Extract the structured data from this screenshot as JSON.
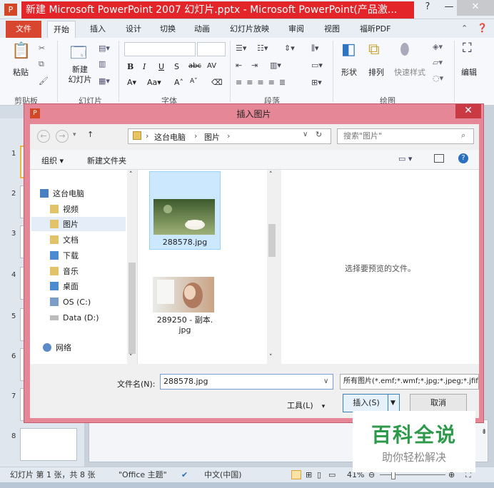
{
  "window": {
    "title": "新建 Microsoft PowerPoint 2007 幻灯片.pptx - Microsoft PowerPoint(产品激..."
  },
  "ribbon": {
    "tabs": [
      "文件",
      "开始",
      "插入",
      "设计",
      "切换",
      "动画",
      "幻灯片放映",
      "审阅",
      "视图",
      "福昕PDF"
    ],
    "groups": {
      "clipboard": {
        "label": "剪贴板",
        "paste": "粘贴"
      },
      "slides": {
        "label": "幻灯片",
        "new_slide": "新建\n幻灯片"
      },
      "font": {
        "label": "字体"
      },
      "paragraph": {
        "label": "段落"
      },
      "drawing": {
        "label": "绘图",
        "shapes": "形状",
        "arrange": "排列",
        "quick_styles": "快速样式"
      },
      "editing": {
        "label": "编辑"
      }
    }
  },
  "slides": {
    "numbers": [
      "1",
      "2",
      "3",
      "4",
      "5",
      "6",
      "7",
      "8"
    ]
  },
  "dialog": {
    "title": "插入图片",
    "breadcrumb": [
      "这台电脑",
      "图片"
    ],
    "search_placeholder": "搜索\"图片\"",
    "organize": "组织 ▾",
    "new_folder": "新建文件夹",
    "nav": [
      {
        "label": "这台电脑",
        "icon": "computer-icon"
      },
      {
        "label": "视频",
        "icon": "video-folder-icon"
      },
      {
        "label": "图片",
        "icon": "pictures-folder-icon"
      },
      {
        "label": "文档",
        "icon": "documents-folder-icon"
      },
      {
        "label": "下载",
        "icon": "downloads-folder-icon"
      },
      {
        "label": "音乐",
        "icon": "music-folder-icon"
      },
      {
        "label": "桌面",
        "icon": "desktop-folder-icon"
      },
      {
        "label": "OS (C:)",
        "icon": "drive-icon"
      },
      {
        "label": "Data (D:)",
        "icon": "drive-icon"
      },
      {
        "label": "网络",
        "icon": "network-icon"
      }
    ],
    "files": [
      {
        "name": "288578.jpg",
        "selected": true
      },
      {
        "name": "289250 - 副本.\njpg",
        "selected": false
      }
    ],
    "preview_text": "选择要预览的文件。",
    "filename_label": "文件名(N):",
    "filename_value": "288578.jpg",
    "filetype_value": "所有图片(*.emf;*.wmf;*.jpg;*.jpeg;*.jfif;*.j",
    "tools": "工具(L)",
    "insert": "插入(S)",
    "cancel": "取消"
  },
  "statusbar": {
    "slide_info": "幻灯片 第 1 张，共 8 张",
    "theme": "\"Office 主题\"",
    "language": "中文(中国)",
    "zoom": "41%"
  },
  "watermark": {
    "title": "百科全说",
    "subtitle": "助你轻松解决"
  },
  "colors": {
    "title_red": "#e3252a",
    "file_tab": "#d9462f",
    "dialog_frame": "#e58796",
    "selection": "#cce8ff"
  }
}
